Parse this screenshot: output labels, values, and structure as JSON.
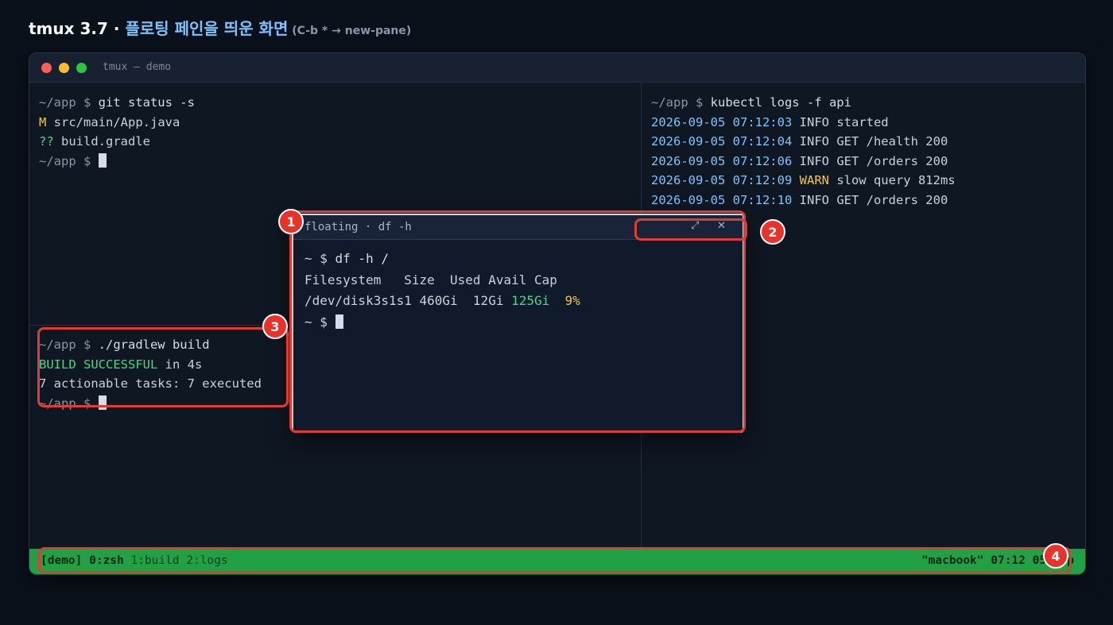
{
  "header": {
    "prefix": "tmux 3.7 · ",
    "title": "플로팅 페인을 띄운 화면",
    "hint": " (C-b * → new-pane)"
  },
  "window": {
    "title": "tmux — demo"
  },
  "panes": {
    "top_left": {
      "lines": [
        {
          "prompt": "~/app $ ",
          "cmd": "git status -s"
        },
        {
          "status": "M",
          "text": " src/main/App.java"
        },
        {
          "status": "??",
          "text": " build.gradle"
        },
        {
          "prompt": "~/app $ "
        }
      ]
    },
    "bottom_left": {
      "prompt1": "~/app $ ",
      "cmd1": "./gradlew build",
      "success": "BUILD SUCCESSFUL",
      "success_rest": " in 4s",
      "tasks": "7 actionable tasks: 7 executed",
      "prompt2": "~/app $ "
    },
    "right": {
      "prompt": "~/app $ ",
      "cmd": "kubectl logs -f api",
      "logs": [
        {
          "ts": "2026-09-05 07:12:03",
          "level": "INFO",
          "msg": " started"
        },
        {
          "ts": "2026-09-05 07:12:04",
          "level": "INFO",
          "msg": " GET /health 200"
        },
        {
          "ts": "2026-09-05 07:12:06",
          "level": "INFO",
          "msg": " GET /orders 200"
        },
        {
          "ts": "2026-09-05 07:12:09",
          "level": "WARN",
          "msg": " slow query 812ms"
        },
        {
          "ts": "2026-09-05 07:12:10",
          "level": "INFO",
          "msg": " GET /orders 200"
        }
      ]
    }
  },
  "floating": {
    "title": "floating · df -h",
    "expand_icon": "⤢",
    "close_icon": "✕",
    "prompt": "~ $ ",
    "cmd": "df -h /",
    "header": "Filesystem   Size  Used Avail Cap",
    "fs": "/dev/disk3s1s1",
    "size": " 460Gi",
    "used": "  12Gi ",
    "avail": "125Gi",
    "cap": "  9%",
    "prompt2": "~ $ "
  },
  "status_bar": {
    "session": "[demo] ",
    "win0": "0:zsh",
    "win1": " 1:build",
    "win2": " 2:logs",
    "right": "\"macbook\" 07:12 05-Sep"
  },
  "callouts": [
    "1",
    "2",
    "3",
    "4"
  ],
  "colors": {
    "status_bg": "#22a046",
    "callout": "#e23b33",
    "accent": "#7cc4ff"
  }
}
